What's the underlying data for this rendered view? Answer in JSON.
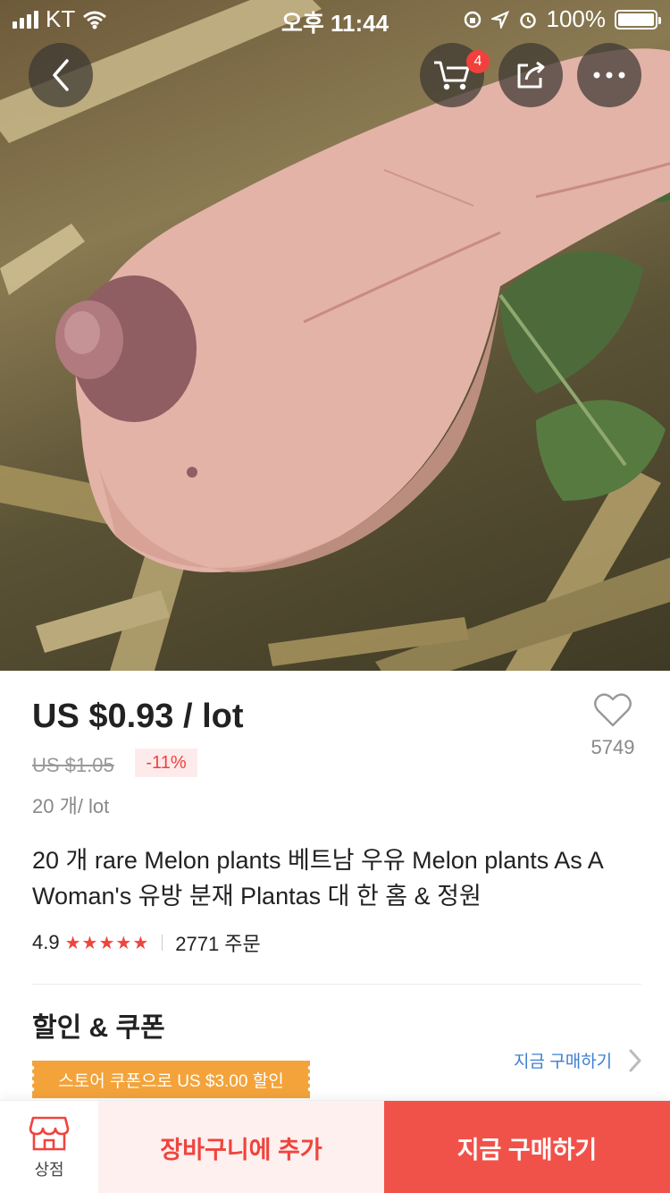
{
  "status_bar": {
    "carrier": "KT",
    "time": "오후 11:44",
    "battery": "100%"
  },
  "header": {
    "cart_badge": "4"
  },
  "product": {
    "price": "US $0.93 / lot",
    "original_price": "US $1.05",
    "discount": "-11%",
    "unit": "20 개/ lot",
    "wishlist_count": "5749",
    "title": "20 개 rare Melon plants 베트남 우유 Melon plants As A Woman's 유방 분재 Plantas 대 한 홈 & 정원",
    "rating": "4.9",
    "stars": "★★★★★",
    "orders": "2771 주문"
  },
  "coupons": {
    "section_title": "할인 & 쿠폰",
    "buy_link": "지금 구매하기",
    "coupon_label": "스토어 쿠폰으로 US $3.00 할인"
  },
  "bottom_bar": {
    "store_label": "상점",
    "add_to_cart": "장바구니에 추가",
    "buy_now": "지금 구매하기"
  },
  "colors": {
    "accent": "#f0443e",
    "link": "#3d7fd1",
    "coupon": "#f3a33a"
  }
}
